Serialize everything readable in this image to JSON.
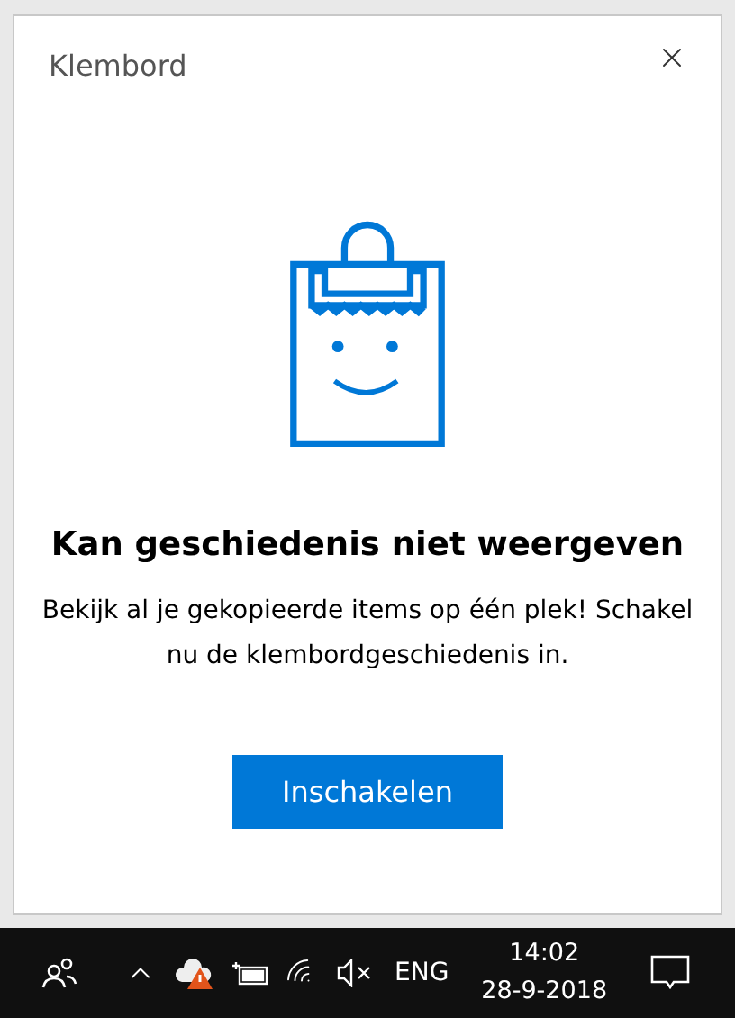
{
  "panel": {
    "title": "Klembord",
    "heading": "Kan geschiedenis niet weergeven",
    "message": "Bekijk al je gekopieerde items op één plek! Schakel nu de klembordgeschiedenis in.",
    "button": "Inschakelen"
  },
  "taskbar": {
    "language": "ENG",
    "time": "14:02",
    "date": "28-9-2018"
  }
}
